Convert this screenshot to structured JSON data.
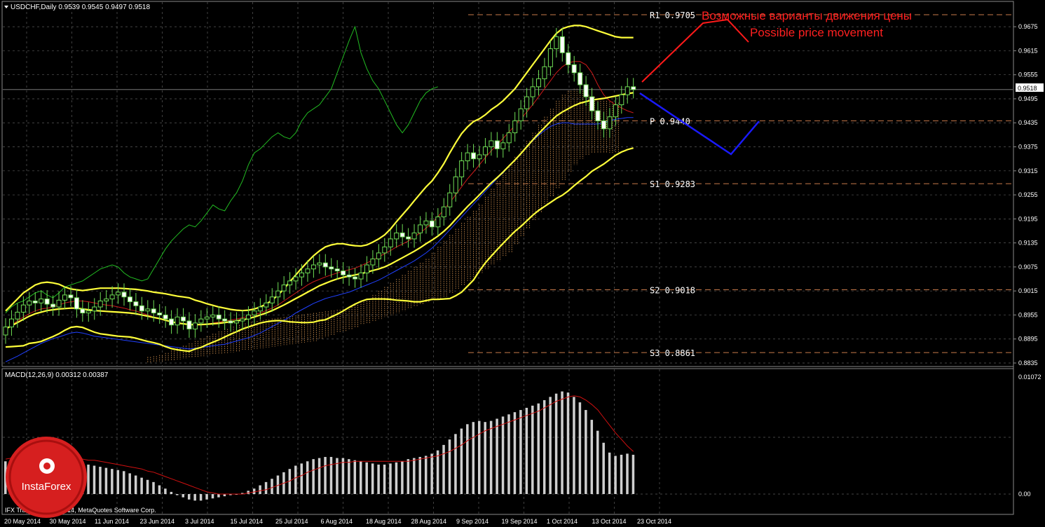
{
  "header": {
    "symbol_line": "USDCHF,Daily  0.9539 0.9545 0.9497 0.9518",
    "macd_line": "MACD(12,26,9) 0.00312 0.00387",
    "copyright": "IFX Trader, © 2001-2014, MetaQuotes Software Corp.",
    "logo_text": "InstaForex"
  },
  "annotations": {
    "ru": "Возможные варианты движения цены",
    "en": "Possible price movement"
  },
  "pivot_levels": [
    {
      "name": "R1",
      "label": "R1  0.9705",
      "value": 0.9705
    },
    {
      "name": "P",
      "label": "P  0.9440",
      "value": 0.944
    },
    {
      "name": "S1",
      "label": "S1  0.9283",
      "value": 0.9283
    },
    {
      "name": "S2",
      "label": "S2  0.9018",
      "value": 0.9018
    },
    {
      "name": "S3",
      "label": "S3  0.8861",
      "value": 0.8861
    }
  ],
  "current_price": "0.9518",
  "colors": {
    "background": "#000000",
    "grid": "#5a5a5a",
    "candle": "#6fdd55",
    "bollinger": "#ffff3a",
    "kijun": "#cc1a1a",
    "tenkan": "#2040ff",
    "chikou": "#22bb22",
    "cloud": "#c88a4a",
    "pivot": "#c87a4a",
    "forecast_up": "#ff1a1a",
    "forecast_down": "#1a1aff",
    "macd_hist": "#cfcfcf",
    "macd_signal": "#d01010",
    "annotation": "#ff2020"
  },
  "chart_data": [
    {
      "type": "candlestick",
      "title": "USDCHF,Daily",
      "ylim": [
        0.8825,
        0.9705
      ],
      "y_ticks": [
        "0.9675",
        "0.9615",
        "0.9555",
        "0.9495",
        "0.9435",
        "0.9375",
        "0.9315",
        "0.9255",
        "0.9195",
        "0.9135",
        "0.9075",
        "0.9015",
        "0.8955",
        "0.8895",
        "0.8835"
      ],
      "x_ticks": [
        "20 May 2014",
        "30 May 2014",
        "11 Jun 2014",
        "23 Jun 2014",
        "3 Jul 2014",
        "15 Jul 2014",
        "25 Jul 2014",
        "6 Aug 2014",
        "18 Aug 2014",
        "28 Aug 2014",
        "9 Sep 2014",
        "19 Sep 2014",
        "1 Oct 2014",
        "13 Oct 2014",
        "23 Oct 2014"
      ],
      "close": [
        0.8925,
        0.8945,
        0.8962,
        0.898,
        0.899,
        0.8985,
        0.8995,
        0.8982,
        0.8975,
        0.8992,
        0.9005,
        0.8998,
        0.897,
        0.896,
        0.8965,
        0.8975,
        0.899,
        0.8995,
        0.9005,
        0.9012,
        0.9,
        0.8988,
        0.8978,
        0.8965,
        0.897,
        0.896,
        0.8955,
        0.8945,
        0.893,
        0.895,
        0.894,
        0.892,
        0.8935,
        0.8945,
        0.895,
        0.8955,
        0.8945,
        0.894,
        0.8935,
        0.894,
        0.8945,
        0.8955,
        0.8965,
        0.8975,
        0.8985,
        0.9,
        0.9015,
        0.903,
        0.904,
        0.905,
        0.906,
        0.907,
        0.908,
        0.9085,
        0.9075,
        0.907,
        0.9065,
        0.9055,
        0.905,
        0.9045,
        0.906,
        0.908,
        0.9095,
        0.911,
        0.9125,
        0.9145,
        0.916,
        0.915,
        0.9145,
        0.916,
        0.918,
        0.919,
        0.9175,
        0.92,
        0.9225,
        0.926,
        0.93,
        0.934,
        0.936,
        0.9345,
        0.9355,
        0.9375,
        0.939,
        0.937,
        0.9385,
        0.941,
        0.944,
        0.947,
        0.95,
        0.9525,
        0.9545,
        0.9575,
        0.962,
        0.965,
        0.961,
        0.958,
        0.956,
        0.953,
        0.95,
        0.9465,
        0.944,
        0.942,
        0.945,
        0.948,
        0.9505,
        0.9525,
        0.9518
      ],
      "bollinger_upper": [
        0.8965,
        0.898,
        0.8995,
        0.901,
        0.902,
        0.903,
        0.9035,
        0.9037,
        0.9035,
        0.9032,
        0.9025,
        0.902,
        0.9018,
        0.9016,
        0.9018,
        0.902,
        0.9022,
        0.9022,
        0.9022,
        0.9022,
        0.9021,
        0.902,
        0.9019,
        0.9017,
        0.9015,
        0.9012,
        0.901,
        0.9008,
        0.9005,
        0.9002,
        0.9,
        0.8998,
        0.8992,
        0.8988,
        0.8983,
        0.8979,
        0.8975,
        0.8972,
        0.8969,
        0.8967,
        0.8966,
        0.8967,
        0.897,
        0.8975,
        0.8982,
        0.8992,
        0.9005,
        0.902,
        0.9038,
        0.9055,
        0.9072,
        0.9088,
        0.9103,
        0.9115,
        0.9125,
        0.913,
        0.9133,
        0.9133,
        0.913,
        0.9128,
        0.9127,
        0.913,
        0.9137,
        0.9145,
        0.9155,
        0.917,
        0.9188,
        0.9205,
        0.9222,
        0.924,
        0.9258,
        0.9275,
        0.929,
        0.931,
        0.9333,
        0.936,
        0.9385,
        0.9408,
        0.9425,
        0.9438,
        0.9445,
        0.9455,
        0.9468,
        0.9478,
        0.949,
        0.9505,
        0.952,
        0.954,
        0.956,
        0.958,
        0.96,
        0.962,
        0.964,
        0.9658,
        0.967,
        0.9675,
        0.9678,
        0.9678,
        0.9675,
        0.967,
        0.9665,
        0.966,
        0.9655,
        0.965,
        0.9648,
        0.9648,
        0.9648
      ],
      "bollinger_middle": [
        0.892,
        0.8928,
        0.8936,
        0.8944,
        0.8952,
        0.8958,
        0.8962,
        0.8966,
        0.8968,
        0.897,
        0.8971,
        0.8972,
        0.8972,
        0.897,
        0.8968,
        0.8966,
        0.8965,
        0.8964,
        0.8963,
        0.8962,
        0.8961,
        0.896,
        0.8958,
        0.8955,
        0.8952,
        0.8949,
        0.8946,
        0.8942,
        0.8938,
        0.8935,
        0.8933,
        0.8931,
        0.8931,
        0.8931,
        0.8932,
        0.8933,
        0.8934,
        0.8936,
        0.8938,
        0.894,
        0.8943,
        0.8946,
        0.895,
        0.8955,
        0.896,
        0.8966,
        0.8973,
        0.898,
        0.8988,
        0.8996,
        0.9004,
        0.9012,
        0.902,
        0.9028,
        0.9034,
        0.904,
        0.9045,
        0.9049,
        0.9052,
        0.9055,
        0.9058,
        0.9062,
        0.9066,
        0.907,
        0.9075,
        0.9082,
        0.909,
        0.9098,
        0.9106,
        0.9114,
        0.9123,
        0.9133,
        0.9142,
        0.9152,
        0.9164,
        0.9178,
        0.9194,
        0.921,
        0.9226,
        0.924,
        0.9255,
        0.927,
        0.9285,
        0.9298,
        0.9312,
        0.9327,
        0.9342,
        0.9358,
        0.9375,
        0.9392,
        0.9408,
        0.9423,
        0.9438,
        0.9452,
        0.9462,
        0.947,
        0.9478,
        0.9484,
        0.9488,
        0.9492,
        0.9494,
        0.9496,
        0.9499,
        0.9502,
        0.9505,
        0.9508,
        0.951
      ],
      "bollinger_lower": [
        0.8875,
        0.8876,
        0.8877,
        0.8878,
        0.8884,
        0.8886,
        0.8889,
        0.8895,
        0.8901,
        0.8908,
        0.8917,
        0.8924,
        0.8926,
        0.8924,
        0.8918,
        0.8912,
        0.8908,
        0.8906,
        0.8904,
        0.8902,
        0.8901,
        0.89,
        0.8897,
        0.8893,
        0.8889,
        0.8886,
        0.8882,
        0.8876,
        0.8871,
        0.8868,
        0.8866,
        0.8864,
        0.887,
        0.8874,
        0.8881,
        0.8887,
        0.8893,
        0.89,
        0.8907,
        0.8913,
        0.892,
        0.8925,
        0.893,
        0.8935,
        0.8938,
        0.894,
        0.8941,
        0.894,
        0.8938,
        0.8937,
        0.8936,
        0.8936,
        0.8937,
        0.8941,
        0.8943,
        0.895,
        0.8957,
        0.8965,
        0.8974,
        0.8982,
        0.8989,
        0.8994,
        0.8995,
        0.8995,
        0.8995,
        0.8994,
        0.8992,
        0.8991,
        0.899,
        0.8988,
        0.8988,
        0.8991,
        0.8994,
        0.8994,
        0.8995,
        0.8996,
        0.9003,
        0.9012,
        0.9027,
        0.9042,
        0.9065,
        0.9085,
        0.9102,
        0.9118,
        0.9134,
        0.9149,
        0.9164,
        0.9176,
        0.919,
        0.9204,
        0.9216,
        0.9226,
        0.9236,
        0.9246,
        0.9254,
        0.9265,
        0.9278,
        0.929,
        0.9301,
        0.9314,
        0.9323,
        0.9332,
        0.9343,
        0.9354,
        0.9362,
        0.9368,
        0.9372
      ],
      "kijun": [
        0.892,
        0.893,
        0.894,
        0.895,
        0.8958,
        0.8965,
        0.897,
        0.8972,
        0.8975,
        0.898,
        0.8985,
        0.8988,
        0.899,
        0.899,
        0.8988,
        0.8985,
        0.8982,
        0.898,
        0.8978,
        0.8975,
        0.8972,
        0.8968,
        0.8965,
        0.896,
        0.8955,
        0.895,
        0.8946,
        0.8942,
        0.8938,
        0.8935,
        0.8933,
        0.893,
        0.893,
        0.893,
        0.8932,
        0.8935,
        0.8937,
        0.894,
        0.8942,
        0.8945,
        0.8948,
        0.8952,
        0.8956,
        0.896,
        0.8966,
        0.8972,
        0.898,
        0.899,
        0.9,
        0.901,
        0.902,
        0.903,
        0.9038,
        0.9044,
        0.905,
        0.9055,
        0.906,
        0.9064,
        0.9068,
        0.9072,
        0.9078,
        0.9085,
        0.9092,
        0.91,
        0.9108,
        0.9116,
        0.9125,
        0.9132,
        0.914,
        0.915,
        0.916,
        0.9172,
        0.9185,
        0.92,
        0.9218,
        0.9236,
        0.9255,
        0.9275,
        0.9295,
        0.9312,
        0.933,
        0.9348,
        0.9365,
        0.938,
        0.9396,
        0.9412,
        0.9428,
        0.9445,
        0.9462,
        0.948,
        0.95,
        0.952,
        0.954,
        0.956,
        0.9575,
        0.9585,
        0.9588,
        0.9588,
        0.958,
        0.956,
        0.953,
        0.9505,
        0.949,
        0.948,
        0.9472,
        0.9465,
        0.946
      ],
      "tenkan": [
        0.8838,
        0.8845,
        0.8852,
        0.886,
        0.8868,
        0.8876,
        0.8884,
        0.889,
        0.8896,
        0.89,
        0.8905,
        0.891,
        0.8912,
        0.891,
        0.8906,
        0.8902,
        0.89,
        0.8898,
        0.8896,
        0.8894,
        0.8892,
        0.889,
        0.8888,
        0.8886,
        0.8884,
        0.8882,
        0.888,
        0.8878,
        0.8876,
        0.8874,
        0.8872,
        0.887,
        0.8872,
        0.8874,
        0.8876,
        0.8878,
        0.888,
        0.8882,
        0.8886,
        0.889,
        0.8894,
        0.8898,
        0.8904,
        0.891,
        0.8918,
        0.8926,
        0.8934,
        0.8942,
        0.895,
        0.896,
        0.8968,
        0.8976,
        0.8984,
        0.899,
        0.8996,
        0.9,
        0.9004,
        0.9008,
        0.9012,
        0.9018,
        0.9024,
        0.903,
        0.9036,
        0.9042,
        0.905,
        0.9058,
        0.9066,
        0.9074,
        0.9082,
        0.909,
        0.91,
        0.911,
        0.9122,
        0.9136,
        0.9152,
        0.9168,
        0.9184,
        0.92,
        0.9216,
        0.9232,
        0.9248,
        0.9264,
        0.928,
        0.9296,
        0.931,
        0.9326,
        0.9342,
        0.9358,
        0.9374,
        0.939,
        0.9404,
        0.9416,
        0.9426,
        0.9432,
        0.9435,
        0.9435,
        0.9432,
        0.9432,
        0.9432,
        0.9432,
        0.9432,
        0.9435,
        0.944,
        0.9444,
        0.9446,
        0.9448,
        0.9448
      ],
      "chikou": [
        0.896,
        0.8975,
        0.8985,
        0.899,
        0.9,
        0.901,
        0.9015,
        0.9005,
        0.8998,
        0.901,
        0.9025,
        0.903,
        0.9035,
        0.904,
        0.905,
        0.906,
        0.907,
        0.9075,
        0.908,
        0.9075,
        0.906,
        0.905,
        0.9045,
        0.904,
        0.9045,
        0.907,
        0.9095,
        0.912,
        0.914,
        0.9155,
        0.917,
        0.918,
        0.9175,
        0.919,
        0.921,
        0.923,
        0.922,
        0.9215,
        0.924,
        0.926,
        0.929,
        0.933,
        0.936,
        0.937,
        0.9385,
        0.94,
        0.941,
        0.94,
        0.9395,
        0.941,
        0.944,
        0.946,
        0.947,
        0.948,
        0.95,
        0.952,
        0.956,
        0.96,
        0.964,
        0.9675,
        0.961,
        0.957,
        0.954,
        0.952,
        0.949,
        0.946,
        0.943,
        0.941,
        0.943,
        0.946,
        0.949,
        0.951,
        0.952,
        0.9525
      ],
      "cloud_top": [
        0.885,
        0.8852,
        0.8855,
        0.886,
        0.8866,
        0.8872,
        0.8878,
        0.8884,
        0.889,
        0.8896,
        0.8902,
        0.8908,
        0.8914,
        0.892,
        0.8926,
        0.893,
        0.8934,
        0.8938,
        0.894,
        0.8942,
        0.8944,
        0.8946,
        0.8948,
        0.895,
        0.8952,
        0.8954,
        0.8956,
        0.8958,
        0.896,
        0.8962,
        0.8964,
        0.8966,
        0.8968,
        0.897,
        0.8975,
        0.898,
        0.8988,
        0.8995,
        0.9005,
        0.9015,
        0.9025,
        0.9035,
        0.9045,
        0.9055,
        0.9065,
        0.9075,
        0.9085,
        0.9095,
        0.911,
        0.9125,
        0.914,
        0.9155,
        0.917,
        0.9185,
        0.92,
        0.9215,
        0.923,
        0.925,
        0.927,
        0.929,
        0.931,
        0.933,
        0.935,
        0.937,
        0.939,
        0.941,
        0.943,
        0.945,
        0.947,
        0.949,
        0.9505,
        0.9515,
        0.952,
        0.9515,
        0.9505,
        0.95,
        0.9495,
        0.949,
        0.9488,
        0.9485
      ],
      "cloud_bottom": [
        0.8835,
        0.8836,
        0.8838,
        0.884,
        0.8842,
        0.8844,
        0.8846,
        0.8848,
        0.885,
        0.8852,
        0.8854,
        0.8856,
        0.8858,
        0.886,
        0.8862,
        0.8864,
        0.8866,
        0.8868,
        0.887,
        0.8872,
        0.8874,
        0.8876,
        0.8878,
        0.888,
        0.8882,
        0.8884,
        0.8886,
        0.8888,
        0.889,
        0.8895,
        0.89,
        0.8905,
        0.891,
        0.8915,
        0.892,
        0.8925,
        0.893,
        0.8935,
        0.894,
        0.8945,
        0.895,
        0.8955,
        0.896,
        0.8965,
        0.897,
        0.8975,
        0.898,
        0.8985,
        0.899,
        0.8995,
        0.9,
        0.901,
        0.902,
        0.903,
        0.904,
        0.905,
        0.906,
        0.907,
        0.908,
        0.909,
        0.91,
        0.911,
        0.913,
        0.915,
        0.917,
        0.919,
        0.921,
        0.923,
        0.925,
        0.927,
        0.929,
        0.931,
        0.933,
        0.9345,
        0.9355,
        0.936,
        0.936,
        0.936,
        0.936,
        0.936
      ]
    },
    {
      "type": "bar",
      "title": "MACD(12,26,9) 0.00312 0.00387",
      "ylim": [
        -0.0007,
        0.01072
      ],
      "y_ticks": [
        "0.01072",
        "0.00"
      ],
      "histogram": [
        0.003,
        0.0032,
        0.0034,
        0.0035,
        0.0036,
        0.0036,
        0.0035,
        0.0034,
        0.0033,
        0.0032,
        0.0031,
        0.003,
        0.0029,
        0.0028,
        0.0027,
        0.0026,
        0.0025,
        0.0024,
        0.0023,
        0.0022,
        0.0021,
        0.0019,
        0.0017,
        0.0015,
        0.0013,
        0.0011,
        0.0008,
        0.0005,
        0.0002,
        -0.0001,
        -0.0003,
        -0.0005,
        -0.0006,
        -0.0006,
        -0.0005,
        -0.0004,
        -0.0003,
        -0.0002,
        -0.0001,
        0.0,
        0.0001,
        0.0003,
        0.0005,
        0.0008,
        0.0011,
        0.0014,
        0.0017,
        0.002,
        0.0023,
        0.0026,
        0.0028,
        0.003,
        0.0032,
        0.0033,
        0.0034,
        0.0034,
        0.0033,
        0.0033,
        0.0032,
        0.0031,
        0.003,
        0.0029,
        0.0028,
        0.0027,
        0.0027,
        0.0028,
        0.0029,
        0.003,
        0.0032,
        0.0033,
        0.0034,
        0.0035,
        0.0037,
        0.004,
        0.0045,
        0.005,
        0.0055,
        0.006,
        0.0064,
        0.0066,
        0.0067,
        0.0066,
        0.0067,
        0.0069,
        0.0071,
        0.0073,
        0.0075,
        0.0077,
        0.0079,
        0.0081,
        0.0083,
        0.0086,
        0.0089,
        0.0092,
        0.0094,
        0.0093,
        0.0089,
        0.0084,
        0.0077,
        0.0068,
        0.0058,
        0.0047,
        0.0038,
        0.0035,
        0.0036,
        0.0037,
        0.0036
      ],
      "signal": [
        0.0032,
        0.0033,
        0.0033,
        0.0034,
        0.0034,
        0.0035,
        0.0035,
        0.0035,
        0.0035,
        0.0034,
        0.0034,
        0.0033,
        0.0033,
        0.0032,
        0.0031,
        0.0031,
        0.003,
        0.0029,
        0.0028,
        0.0027,
        0.0026,
        0.0025,
        0.0024,
        0.0023,
        0.0021,
        0.002,
        0.0018,
        0.0016,
        0.0014,
        0.0012,
        0.001,
        0.0008,
        0.0006,
        0.0004,
        0.0002,
        0.0001,
        0.0,
        0.0,
        0.0,
        0.0,
        0.0,
        0.0001,
        0.0002,
        0.0003,
        0.0004,
        0.0006,
        0.0008,
        0.001,
        0.0012,
        0.0015,
        0.0017,
        0.002,
        0.0022,
        0.0024,
        0.0026,
        0.0027,
        0.0028,
        0.0029,
        0.0029,
        0.003,
        0.003,
        0.003,
        0.003,
        0.003,
        0.003,
        0.003,
        0.003,
        0.003,
        0.003,
        0.0031,
        0.0032,
        0.0033,
        0.0034,
        0.0035,
        0.0037,
        0.0039,
        0.0042,
        0.0045,
        0.0049,
        0.0052,
        0.0055,
        0.0058,
        0.006,
        0.0062,
        0.0064,
        0.0066,
        0.0068,
        0.007,
        0.0072,
        0.0074,
        0.0076,
        0.0079,
        0.0082,
        0.0085,
        0.0087,
        0.0089,
        0.009,
        0.0089,
        0.0086,
        0.0082,
        0.0077,
        0.007,
        0.0063,
        0.0056,
        0.005,
        0.0044,
        0.0039
      ]
    }
  ]
}
